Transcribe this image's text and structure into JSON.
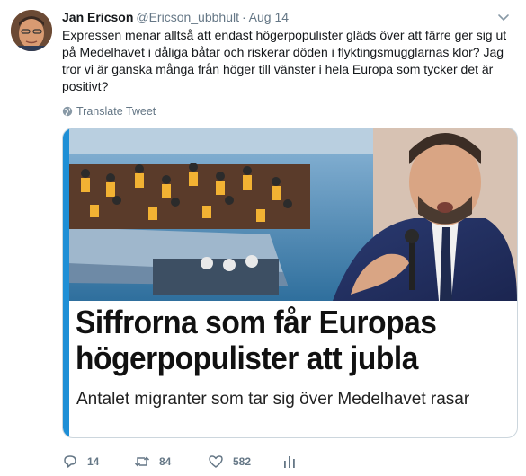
{
  "tweet": {
    "author_name": "Jan Ericson",
    "handle": "@Ericson_ubbhult",
    "separator": "·",
    "date": "Aug 14",
    "text": "Expressen menar alltså att endast högerpopulister gläds över att färre ger sig ut på Medelhavet i dåliga båtar och riskerar döden i flyktingsmugglarnas klor? Jag tror vi är ganska många från höger till vänster i hela Europa som tycker det är positivt?",
    "translate_label": "Translate Tweet"
  },
  "card": {
    "headline": "Siffrorna som får Europas högerpopulister att jubla",
    "subheadline": "Antalet migranter som tar sig över Medelhavet rasar",
    "accent_color": "#1e8fd6"
  },
  "actions": {
    "reply_count": "14",
    "retweet_count": "84",
    "like_count": "582"
  },
  "icons": {
    "avatar": "profile-photo",
    "caret": "chevron-down-icon",
    "translate": "globe-icon",
    "reply": "reply-icon",
    "retweet": "retweet-icon",
    "like": "heart-icon",
    "analytics": "analytics-icon"
  }
}
